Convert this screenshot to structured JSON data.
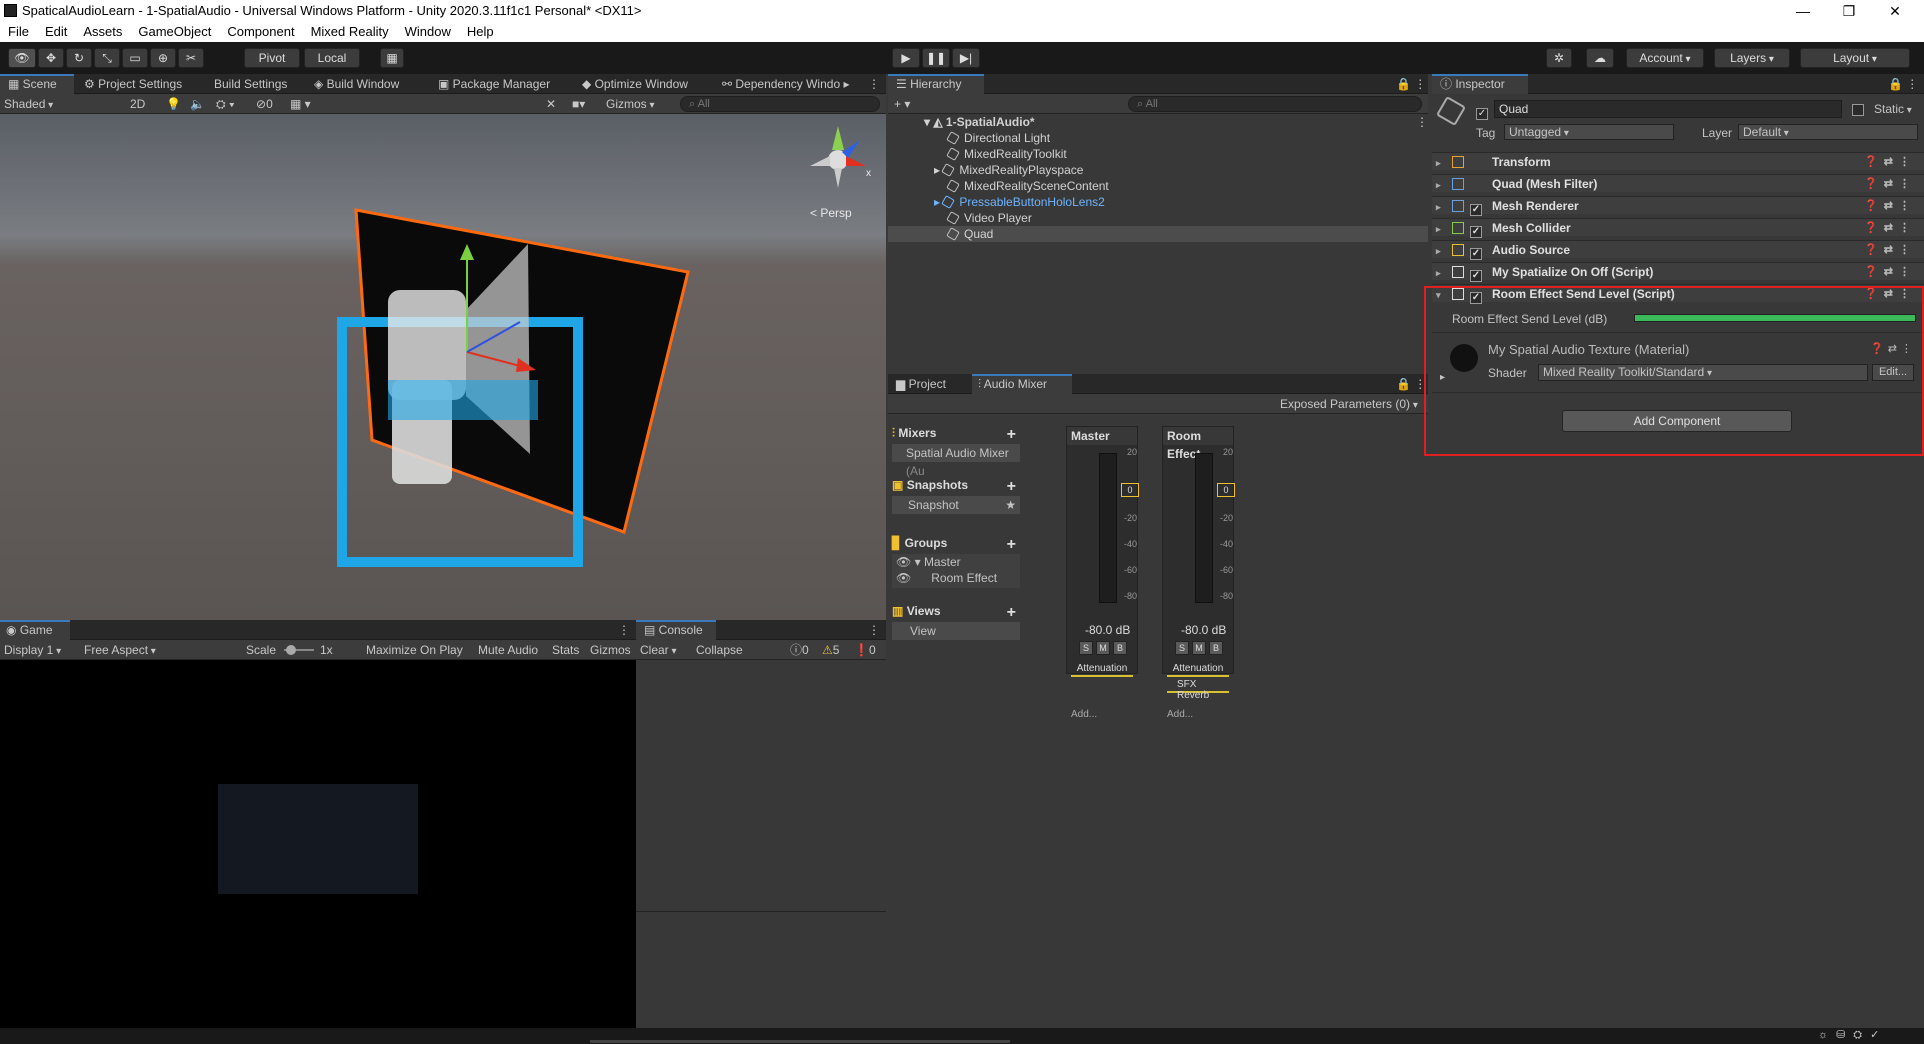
{
  "title_bar": {
    "title": "SpaticalAudioLearn - 1-SpatialAudio - Universal Windows Platform - Unity 2020.3.11f1c1 Personal* <DX11>"
  },
  "menu": [
    "File",
    "Edit",
    "Assets",
    "GameObject",
    "Component",
    "Mixed Reality",
    "Window",
    "Help"
  ],
  "toolbar": {
    "pivot": "Pivot",
    "local": "Local",
    "account": "Account",
    "layers": "Layers",
    "layout": "Layout"
  },
  "scene_tabs": [
    "Scene",
    "Project Settings",
    "Build Settings",
    "Build Window",
    "Package Manager",
    "Optimize Window",
    "Dependency Windo"
  ],
  "scene_bar": {
    "shading": "Shaded",
    "mode_2d": "2D",
    "hidden_count": "0",
    "gizmos": "Gizmos",
    "search_placeholder": "All",
    "persp": "Persp"
  },
  "game_panel": {
    "tab": "Game",
    "display": "Display 1",
    "aspect": "Free Aspect",
    "scale_label": "Scale",
    "scale_value": "1x",
    "maximize": "Maximize On Play",
    "mute": "Mute Audio",
    "stats": "Stats",
    "gizmos": "Gizmos"
  },
  "console_panel": {
    "tab": "Console",
    "clear": "Clear",
    "collapse": "Collapse",
    "log_count": "0",
    "warn_count": "5",
    "error_count": "0"
  },
  "hierarchy": {
    "tab": "Hierarchy",
    "search_placeholder": "All",
    "scene": "1-SpatialAudio*",
    "items": [
      "Directional Light",
      "MixedRealityToolkit",
      "MixedRealityPlayspace",
      "MixedRealitySceneContent",
      "PressableButtonHoloLens2",
      "Video Player",
      "Quad"
    ]
  },
  "audio_mixer": {
    "tabs": [
      "Project",
      "Audio Mixer"
    ],
    "exposed": "Exposed Parameters (0)",
    "mixers_label": "Mixers",
    "mixer_item": "Spatial Audio Mixer",
    "mixer_item_suffix": "(Au",
    "snapshots_label": "Snapshots",
    "snapshot_item": "Snapshot",
    "groups_label": "Groups",
    "group_master": "Master",
    "group_child": "Room Effect",
    "views_label": "Views",
    "view_item": "View",
    "strips": [
      {
        "name": "Master",
        "db": "-80.0 dB",
        "effects": [
          "Attenuation"
        ],
        "add": "Add...",
        "marker": "0"
      },
      {
        "name": "Room Effect",
        "db": "-80.0 dB",
        "effects": [
          "Attenuation",
          "SFX Reverb"
        ],
        "add": "Add...",
        "marker": "0"
      }
    ],
    "scale": [
      "20",
      "0",
      "-20",
      "-40",
      "-60",
      "-80"
    ],
    "smb": [
      "S",
      "M",
      "B"
    ]
  },
  "inspector": {
    "tab": "Inspector",
    "object_name": "Quad",
    "static": "Static",
    "tag_label": "Tag",
    "tag_value": "Untagged",
    "layer_label": "Layer",
    "layer_value": "Default",
    "components": [
      {
        "name": "Transform",
        "check": false,
        "color": "#e8a030"
      },
      {
        "name": "Quad (Mesh Filter)",
        "check": false,
        "color": "#6aa0e0"
      },
      {
        "name": "Mesh Renderer",
        "check": true,
        "color": "#6aa0e0"
      },
      {
        "name": "Mesh Collider",
        "check": true,
        "color": "#8cc84a"
      },
      {
        "name": "Audio Source",
        "check": true,
        "color": "#e8c030"
      },
      {
        "name": "My Spatialize On Off (Script)",
        "check": true,
        "color": "#ddd"
      },
      {
        "name": "Room Effect Send Level (Script)",
        "check": true,
        "color": "#ddd"
      }
    ],
    "field_label": "Room Effect Send Level (dB)",
    "material_name": "My Spatial Audio Texture (Material)",
    "shader_label": "Shader",
    "shader_value": "Mixed Reality Toolkit/Standard",
    "edit": "Edit...",
    "add_component": "Add Component"
  }
}
